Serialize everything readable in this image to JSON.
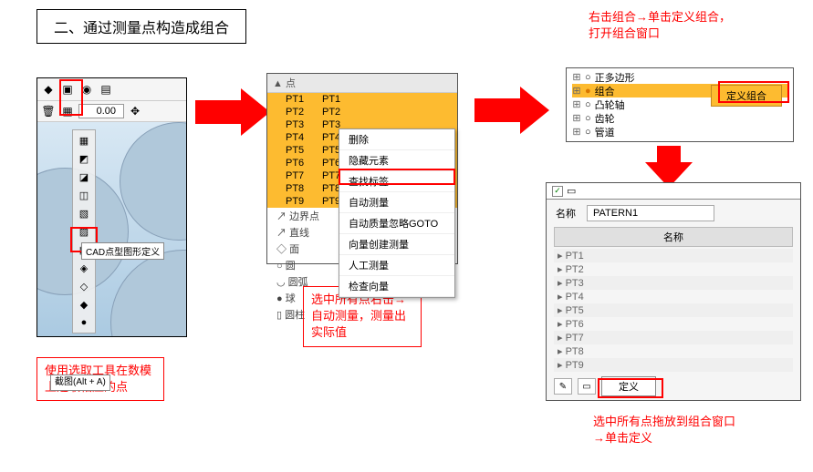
{
  "title": "二、通过测量点构造成组合",
  "panel1": {
    "value": "0.00",
    "tooltip_cad": "CAD点型图形定义",
    "tooltip_alt": "截图(Alt + A)"
  },
  "caption1": "使用选取工具在数模上选取相应的点",
  "panel2": {
    "header": "▲ 点",
    "points": [
      "PT1",
      "PT2",
      "PT3",
      "PT4",
      "PT5",
      "PT6",
      "PT7",
      "PT8",
      "PT9"
    ],
    "tree": [
      "边界点",
      "直线",
      "面",
      "圆",
      "圆弧",
      "球",
      "圆柱"
    ],
    "ctx": [
      "删除",
      "隐藏元素",
      "查找标签",
      "自动测量",
      "自动质量忽略GOTO",
      "向量创建测量",
      "人工测量",
      "检查向量"
    ]
  },
  "caption2": "选中所有点右击→自动测量，测量出实际值",
  "caption_top_right": "右击组合→单击定义组合，打开组合窗口",
  "panel3": {
    "items": [
      "正多边形",
      "组合",
      "凸轮轴",
      "齿轮",
      "管道"
    ],
    "btn": "定义组合"
  },
  "panel4": {
    "label_name": "名称",
    "name_value": "PATERN1",
    "col": "名称",
    "points": [
      "PT1",
      "PT2",
      "PT3",
      "PT4",
      "PT5",
      "PT6",
      "PT7",
      "PT8",
      "PT9"
    ],
    "define": "定义"
  },
  "caption4": "选中所有点拖放到组合窗口→单击定义"
}
